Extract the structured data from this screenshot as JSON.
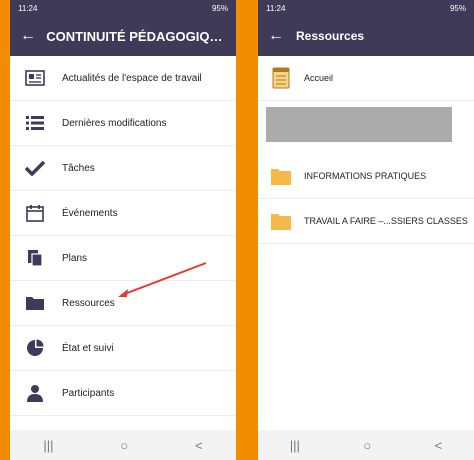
{
  "left": {
    "status": {
      "time": "11:24",
      "right": "95%"
    },
    "appbar": {
      "title": "CONTINUITÉ PÉDAGOGIQUE..."
    },
    "menu": [
      {
        "label": "Actualités de l'espace de travail",
        "icon": "newspaper-icon"
      },
      {
        "label": "Dernières modifications",
        "icon": "list-icon"
      },
      {
        "label": "Tâches",
        "icon": "checkmark-icon"
      },
      {
        "label": "Événements",
        "icon": "calendar-icon"
      },
      {
        "label": "Plans",
        "icon": "document-icon"
      },
      {
        "label": "Ressources",
        "icon": "folder-icon"
      },
      {
        "label": "État et suivi",
        "icon": "pie-chart-icon"
      },
      {
        "label": "Participants",
        "icon": "person-icon"
      }
    ],
    "nav": {
      "recent": "|||",
      "home": "○",
      "back": "<"
    }
  },
  "right": {
    "status": {
      "time": "11:24",
      "right": "95%"
    },
    "appbar": {
      "title": "Ressources"
    },
    "items": [
      {
        "label": "Accueil",
        "icon": "notepad-icon"
      },
      {
        "label": "INFORMATIONS PRATIQUES",
        "icon": "folder-icon"
      },
      {
        "label": "TRAVAIL A FAIRE –...SSIERS CLASSES",
        "icon": "folder-icon"
      }
    ],
    "nav": {
      "recent": "|||",
      "home": "○",
      "back": "<"
    }
  },
  "colors": {
    "bar": "#3e3a58",
    "border": "#f28c00",
    "accent": "#e53935",
    "folder": "#f5b94a"
  }
}
